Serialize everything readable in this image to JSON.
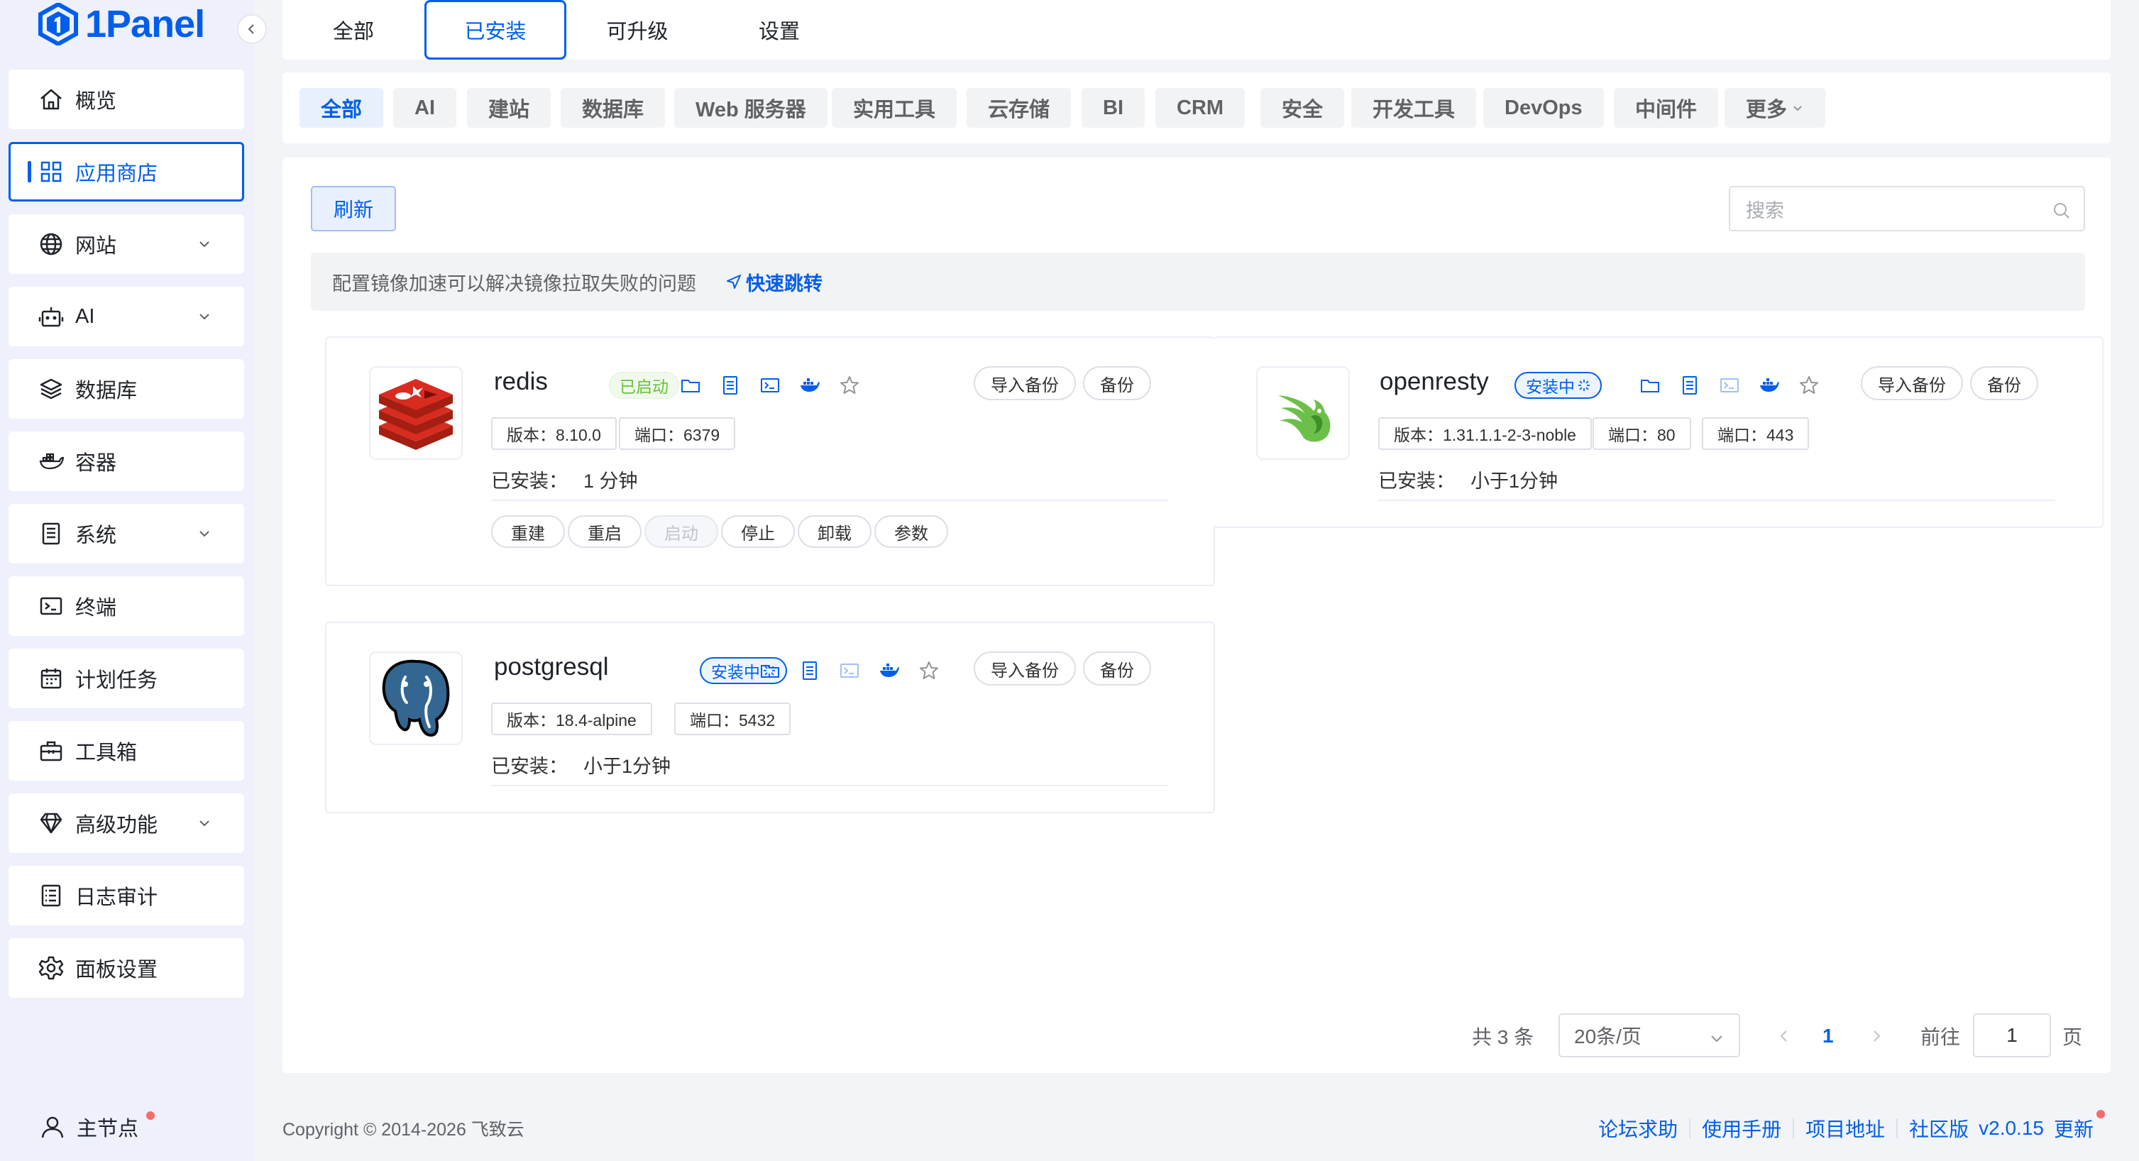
{
  "brand": {
    "name": "1Panel"
  },
  "sidebar": {
    "items": [
      {
        "label": "概览"
      },
      {
        "label": "应用商店"
      },
      {
        "label": "网站"
      },
      {
        "label": "AI"
      },
      {
        "label": "数据库"
      },
      {
        "label": "容器"
      },
      {
        "label": "系统"
      },
      {
        "label": "终端"
      },
      {
        "label": "计划任务"
      },
      {
        "label": "工具箱"
      },
      {
        "label": "高级功能"
      },
      {
        "label": "日志审计"
      },
      {
        "label": "面板设置"
      }
    ],
    "footer": {
      "label": "主节点"
    }
  },
  "tabs": [
    {
      "label": "全部"
    },
    {
      "label": "已安装"
    },
    {
      "label": "可升级"
    },
    {
      "label": "设置"
    }
  ],
  "categories": [
    {
      "label": "全部"
    },
    {
      "label": "AI"
    },
    {
      "label": "建站"
    },
    {
      "label": "数据库"
    },
    {
      "label": "Web 服务器"
    },
    {
      "label": "实用工具"
    },
    {
      "label": "云存储"
    },
    {
      "label": "BI"
    },
    {
      "label": "CRM"
    },
    {
      "label": "安全"
    },
    {
      "label": "开发工具"
    },
    {
      "label": "DevOps"
    },
    {
      "label": "中间件"
    },
    {
      "label": "更多"
    }
  ],
  "toolbar": {
    "refresh_label": "刷新",
    "search_placeholder": "搜索"
  },
  "notice": {
    "text": "配置镜像加速可以解决镜像拉取失败的问题",
    "link": "快速跳转"
  },
  "apps": [
    {
      "name": "redis",
      "status": "已启动",
      "version_tag": "版本：8.10.0",
      "ports": [
        "端口：6379"
      ],
      "installed_label": "已安装：",
      "installed_time": "1 分钟",
      "import_backup": "导入备份",
      "backup": "备份",
      "ops": [
        "重建",
        "重启",
        "启动",
        "停止",
        "卸载",
        "参数"
      ]
    },
    {
      "name": "openresty",
      "status": "安装中",
      "version_tag": "版本：1.31.1.1-2-3-noble",
      "ports": [
        "端口：80",
        "端口：443"
      ],
      "installed_label": "已安装：",
      "installed_time": "小于1分钟",
      "import_backup": "导入备份",
      "backup": "备份"
    },
    {
      "name": "postgresql",
      "status": "安装中",
      "version_tag": "版本：18.4-alpine",
      "ports": [
        "端口：5432"
      ],
      "installed_label": "已安装：",
      "installed_time": "小于1分钟",
      "import_backup": "导入备份",
      "backup": "备份"
    }
  ],
  "pagination": {
    "total": "共 3 条",
    "page_size": "20条/页",
    "current_page": "1",
    "goto_label": "前往",
    "goto_value": "1",
    "page_suffix": "页"
  },
  "footer": {
    "copyright": "Copyright © 2014-2026 飞致云",
    "links": [
      "论坛求助",
      "使用手册",
      "项目地址",
      "社区版"
    ],
    "version": "v2.0.15",
    "update": "更新"
  },
  "colors": {
    "accent": "#005eeb",
    "success": "#67c23a",
    "danger": "#f56c6c"
  }
}
